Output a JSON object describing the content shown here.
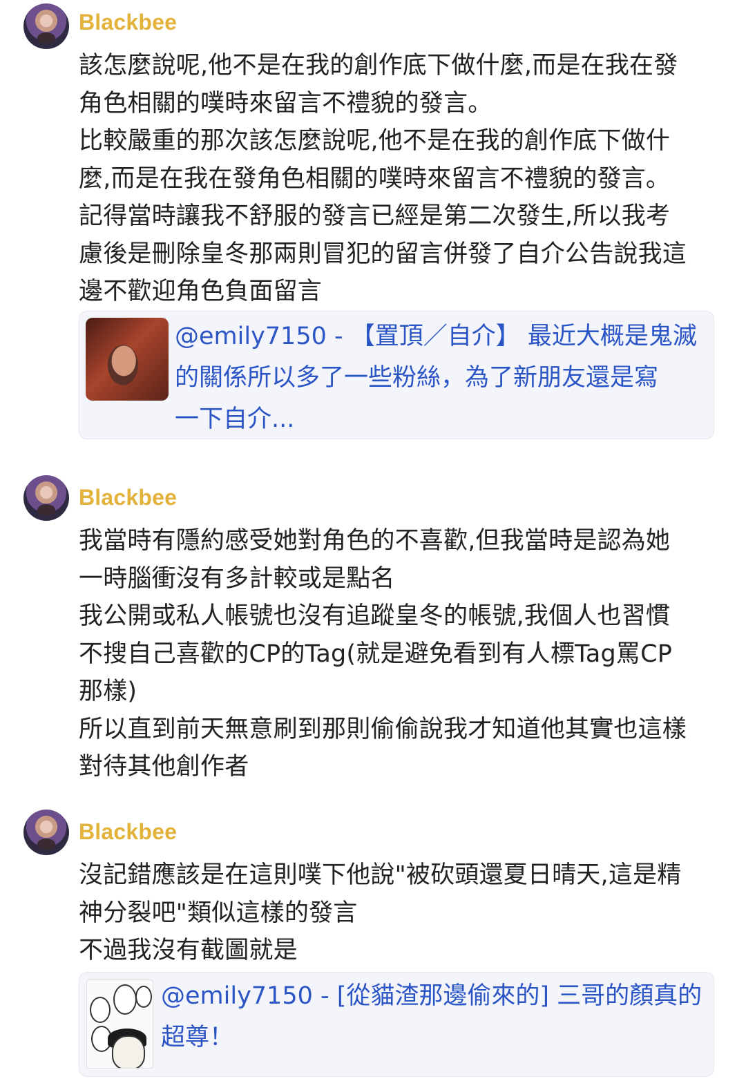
{
  "posts": [
    {
      "username": "Blackbee",
      "lines": [
        "該怎麼說呢,他不是在我的創作底下做什麼,而是在我在發",
        "角色相關的噗時來留言不禮貌的發言。",
        "比較嚴重的那次該怎麼說呢,他不是在我的創作底下做什",
        "麼,而是在我在發角色相關的噗時來留言不禮貌的發言。",
        "記得當時讓我不舒服的發言已經是第二次發生,所以我考",
        "慮後是刪除皇冬那兩則冒犯的留言併發了自介公告說我這",
        "邊不歡迎角色負面留言"
      ],
      "quote": {
        "thumbnail": "photo-thumbnail",
        "lines": [
          "@emily7150 - 【置頂／自介】 最近大概是鬼滅",
          "的關係所以多了一些粉絲，為了新朋友還是寫",
          "一下自介..."
        ]
      }
    },
    {
      "username": "Blackbee",
      "lines": [
        "我當時有隱約感受她對角色的不喜歡,但我當時是認為她",
        "一時腦衝沒有多計較或是點名",
        "我公開或私人帳號也沒有追蹤皇冬的帳號,我個人也習慣",
        "不搜自己喜歡的CP的Tag(就是避免看到有人標Tag罵CP",
        "那樣)",
        "所以直到前天無意刷到那則偷偷說我才知道他其實也這樣",
        "對待其他創作者"
      ]
    },
    {
      "username": "Blackbee",
      "lines": [
        "沒記錯應該是在這則噗下他說\"被砍頭還夏日晴天,這是精",
        "神分裂吧\"類似這樣的發言",
        "不過我沒有截圖就是"
      ],
      "quote": {
        "thumbnail": "manga-thumbnail",
        "lines": [
          "@emily7150 - [從貓渣那邊偷來的] 三哥的顏真的",
          "超尊！"
        ]
      }
    }
  ],
  "colors": {
    "username": "#e2b23b",
    "link": "#2b55c5",
    "quote_bg": "#f3f5fb"
  }
}
